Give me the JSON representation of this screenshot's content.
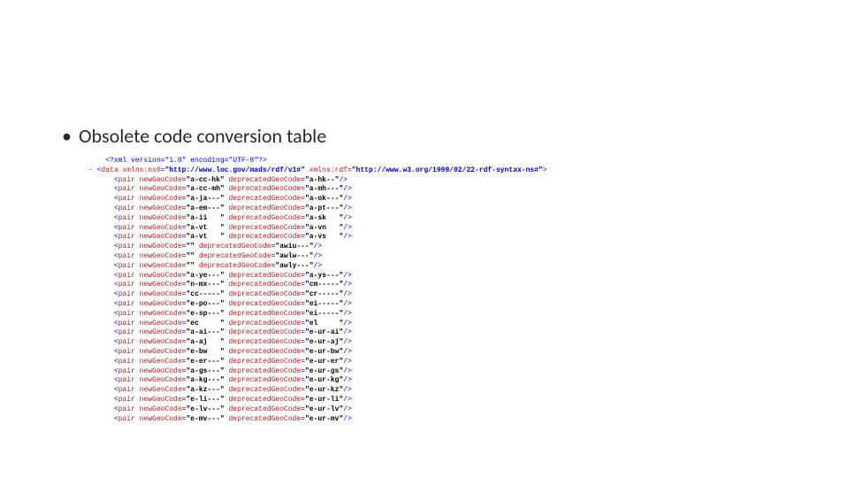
{
  "title": "Obsolete code conversion table",
  "xml": {
    "prolog": "<?xml version=\"1.0\" encoding=\"UTF-8\"?>",
    "root_open_prefix": "<data xmlns:ns0=",
    "ns0_url": "\"http://www.loc.gov/mads/rdf/v1#\"",
    "xmlns_rdf_label": " xmlns:rdf=",
    "rdf_url": "\"http://www.w3.org/1999/02/22-rdf-syntax-ns#\"",
    "root_close": ">",
    "pairs": [
      {
        "new": "a-cc-hk",
        "dep": "a-hk--"
      },
      {
        "new": "a-cc-mh",
        "dep": "a-mh---"
      },
      {
        "new": "a-ja---",
        "dep": "a-ok---"
      },
      {
        "new": "a-em---",
        "dep": "a-pt---"
      },
      {
        "new": "a-ii   ",
        "dep": "a-sk   "
      },
      {
        "new": "a-vt   ",
        "dep": "a-vn   "
      },
      {
        "new": "a-vt   ",
        "dep": "a-vs   "
      },
      {
        "new": "",
        "dep": "awiu---"
      },
      {
        "new": "",
        "dep": "awlw---"
      },
      {
        "new": "",
        "dep": "awly---"
      },
      {
        "new": "a-ye---",
        "dep": "a-ys---"
      },
      {
        "new": "n-mx---",
        "dep": "cm-----"
      },
      {
        "new": "cc-----",
        "dep": "cr-----"
      },
      {
        "new": "e-po---",
        "dep": "ei-----"
      },
      {
        "new": "e-sp---",
        "dep": "ei-----"
      },
      {
        "new": "ec     ",
        "dep": "el     "
      },
      {
        "new": "a-ai---",
        "dep": "e-ur-ai"
      },
      {
        "new": "a-aj   ",
        "dep": "e-ur-aj"
      },
      {
        "new": "e-bw   ",
        "dep": "e-ur-bw"
      },
      {
        "new": "e-er---",
        "dep": "e-ur-er"
      },
      {
        "new": "a-gs---",
        "dep": "e-ur-gs"
      },
      {
        "new": "a-kg---",
        "dep": "e-ur-kg"
      },
      {
        "new": "a-kz---",
        "dep": "e-ur-kz"
      },
      {
        "new": "e-li---",
        "dep": "e-ur-li"
      },
      {
        "new": "e-lv---",
        "dep": "e-ur-lv"
      },
      {
        "new": "e-mv---",
        "dep": "e-ur-mv"
      }
    ]
  }
}
